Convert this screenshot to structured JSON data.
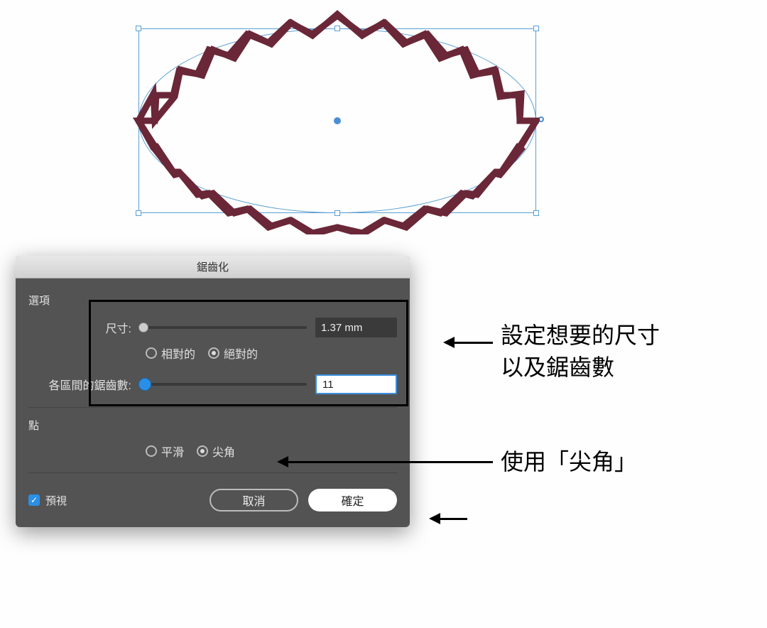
{
  "canvas": {
    "shape_color": "#6a2738",
    "guide_color": "#5a9fd4"
  },
  "dialog": {
    "title": "鋸齒化",
    "options_label": "選項",
    "size_label": "尺寸:",
    "size_value": "1.37 mm",
    "size_slider_pos_pct": 3,
    "relative_label": "相對的",
    "absolute_label": "絕對的",
    "segments_label": "各區間的鋸齒數:",
    "segments_value": "11",
    "segments_slider_pos_pct": 3,
    "points_label": "點",
    "smooth_label": "平滑",
    "corner_label": "尖角",
    "preview_label": "預視",
    "cancel_label": "取消",
    "ok_label": "確定",
    "size_mode": "absolute",
    "point_mode": "corner",
    "preview_checked": true
  },
  "annotations": {
    "line1a": "設定想要的尺寸",
    "line1b": "以及鋸齒數",
    "line2": "使用「尖角」"
  }
}
